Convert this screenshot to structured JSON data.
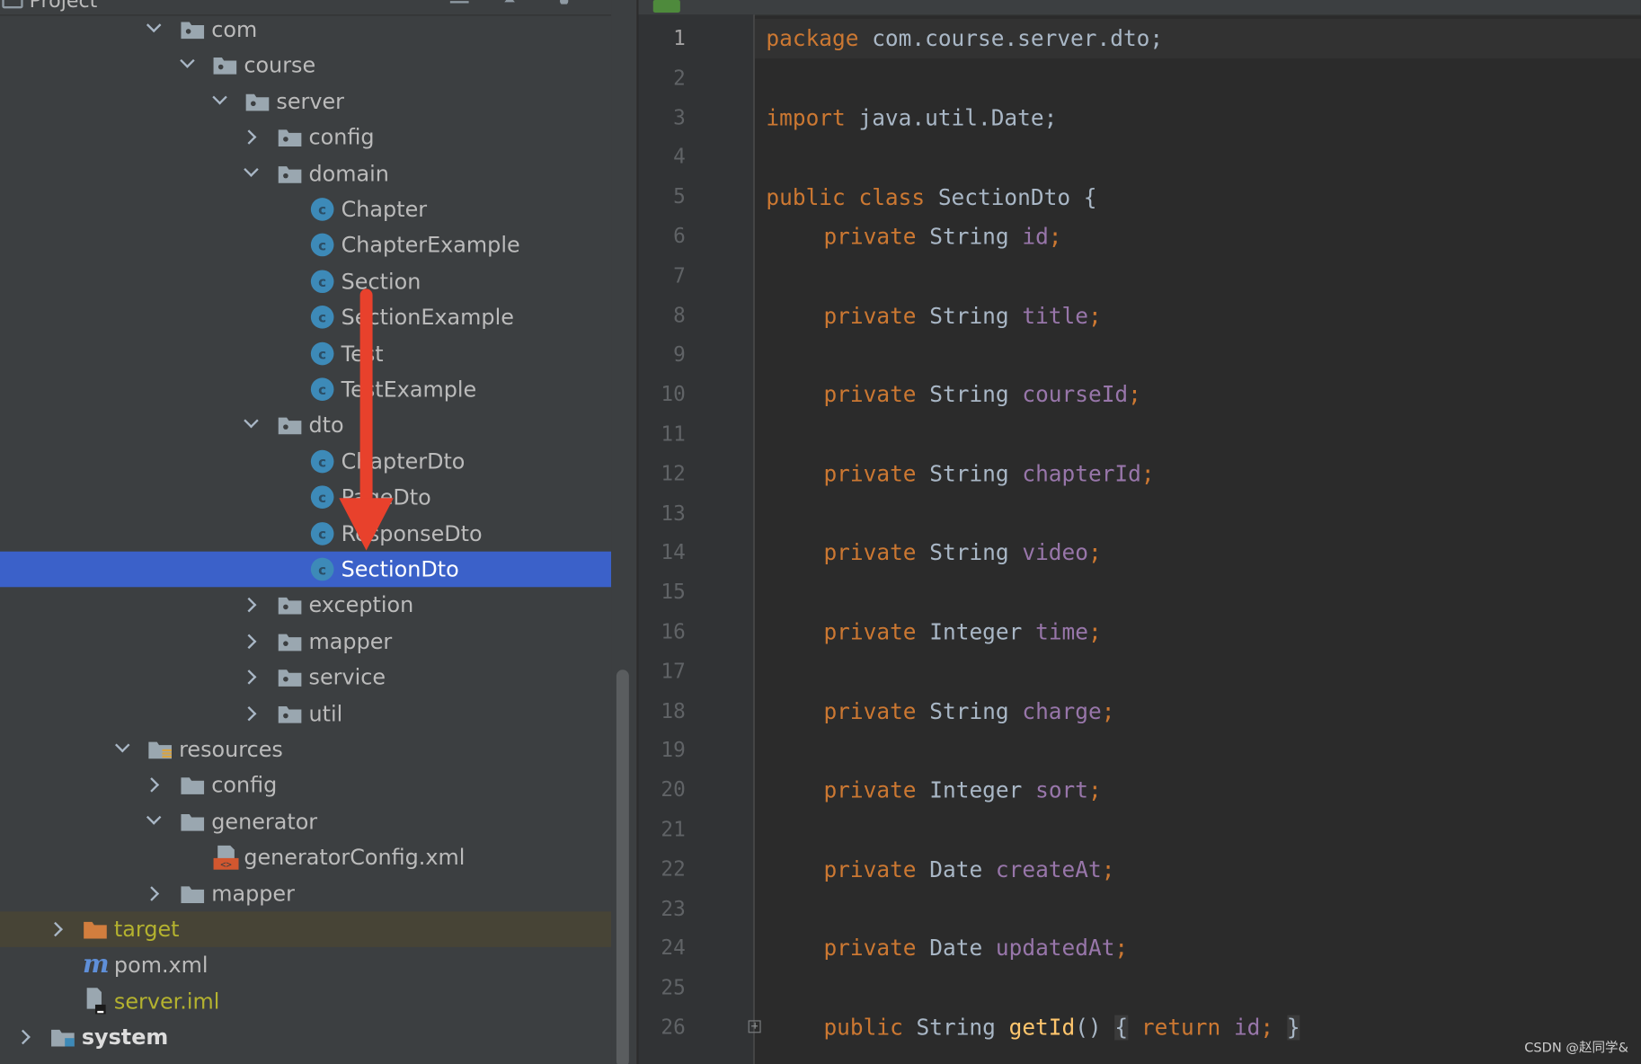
{
  "project_panel": {
    "title": "Project",
    "tree": [
      {
        "label": "com",
        "type": "package",
        "expanded": true
      },
      {
        "label": "course",
        "type": "package",
        "expanded": true
      },
      {
        "label": "server",
        "type": "package",
        "expanded": true
      },
      {
        "label": "config",
        "type": "package",
        "expanded": false
      },
      {
        "label": "domain",
        "type": "package",
        "expanded": true
      },
      {
        "label": "Chapter",
        "type": "class"
      },
      {
        "label": "ChapterExample",
        "type": "class"
      },
      {
        "label": "Section",
        "type": "class"
      },
      {
        "label": "SectionExample",
        "type": "class"
      },
      {
        "label": "Test",
        "type": "class"
      },
      {
        "label": "TestExample",
        "type": "class"
      },
      {
        "label": "dto",
        "type": "package",
        "expanded": true
      },
      {
        "label": "ChapterDto",
        "type": "class"
      },
      {
        "label": "PageDto",
        "type": "class"
      },
      {
        "label": "ResponseDto",
        "type": "class"
      },
      {
        "label": "SectionDto",
        "type": "class",
        "selected": true
      },
      {
        "label": "exception",
        "type": "package",
        "expanded": false
      },
      {
        "label": "mapper",
        "type": "package",
        "expanded": false
      },
      {
        "label": "service",
        "type": "package",
        "expanded": false
      },
      {
        "label": "util",
        "type": "package",
        "expanded": false
      },
      {
        "label": "resources",
        "type": "resources-folder",
        "expanded": true
      },
      {
        "label": "config",
        "type": "folder",
        "expanded": false
      },
      {
        "label": "generator",
        "type": "folder",
        "expanded": true
      },
      {
        "label": "generatorConfig.xml",
        "type": "xml-file"
      },
      {
        "label": "mapper",
        "type": "folder",
        "expanded": false
      },
      {
        "label": "target",
        "type": "excluded-folder",
        "expanded": false
      },
      {
        "label": "pom.xml",
        "type": "maven-file"
      },
      {
        "label": "server.iml",
        "type": "iml-file"
      },
      {
        "label": "system",
        "type": "module",
        "expanded": false
      }
    ]
  },
  "editor": {
    "current_line": 1,
    "line_numbers": [
      "1",
      "2",
      "3",
      "4",
      "5",
      "6",
      "7",
      "8",
      "9",
      "10",
      "11",
      "12",
      "13",
      "14",
      "15",
      "16",
      "17",
      "18",
      "19",
      "20",
      "21",
      "22",
      "23",
      "24",
      "25",
      "26"
    ],
    "code": {
      "l1_kw": "package",
      "l1_rest": " com.course.server.dto;",
      "l3_kw": "import",
      "l3_rest": " java.util.Date;",
      "l5_kw": "public class",
      "l5_rest": " SectionDto {",
      "private_kw": "private",
      "fields": [
        {
          "type": "String",
          "name": "id"
        },
        {
          "type": "String",
          "name": "title"
        },
        {
          "type": "String",
          "name": "courseId"
        },
        {
          "type": "String",
          "name": "chapterId"
        },
        {
          "type": "String",
          "name": "video"
        },
        {
          "type": "Integer",
          "name": "time"
        },
        {
          "type": "String",
          "name": "charge"
        },
        {
          "type": "Integer",
          "name": "sort"
        },
        {
          "type": "Date",
          "name": "createAt"
        },
        {
          "type": "Date",
          "name": "updatedAt"
        }
      ],
      "l26_kw": "public",
      "l26_type": " String ",
      "l26_method": "getId",
      "l26_parens": "()",
      "l26_open": "{",
      "l26_return": "return",
      "l26_field": "id",
      "l26_semicolon": ";",
      "l26_close": "}"
    }
  },
  "watermark": "CSDN @赵同学&"
}
